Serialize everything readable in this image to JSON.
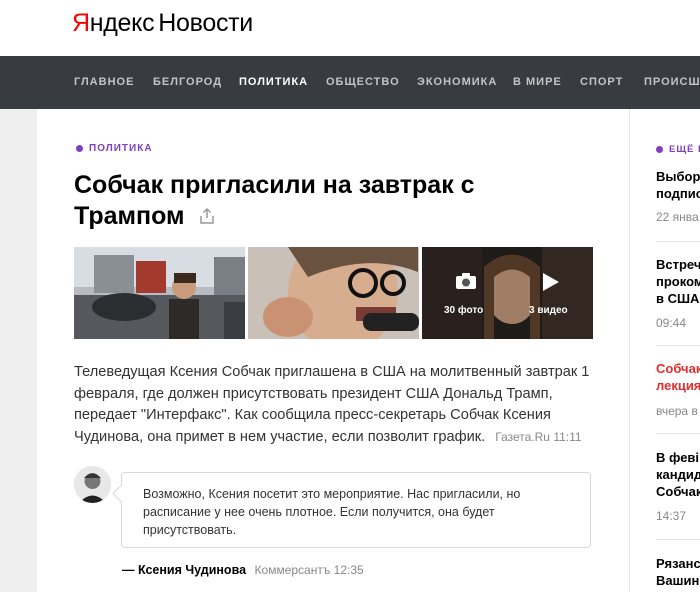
{
  "logo": {
    "brand_first": "Я",
    "brand_rest": "ндекс",
    "service": "Новости"
  },
  "nav": {
    "items": [
      {
        "label": "ГЛАВНОЕ",
        "active": false
      },
      {
        "label": "БЕЛГОРОД",
        "active": false
      },
      {
        "label": "ПОЛИТИКА",
        "active": true
      },
      {
        "label": "ОБЩЕСТВО",
        "active": false
      },
      {
        "label": "ЭКОНОМИКА",
        "active": false
      },
      {
        "label": "В МИРЕ",
        "active": false
      },
      {
        "label": "СПОРТ",
        "active": false
      },
      {
        "label": "ПРОИСШЕСТВИЯ",
        "active": false
      }
    ]
  },
  "article": {
    "rubric": "ПОЛИТИКА",
    "title": "Собчак пригласили на завтрак с Трампом",
    "share_icon": "share-icon",
    "media": {
      "photos_label": "30 фото",
      "videos_label": "3 видео",
      "camera_icon": "camera-icon",
      "play_icon": "play-icon"
    },
    "lead": "Телеведущая Ксения Собчак приглашена в США на молитвенный завтрак 1 февраля, где должен присутствовать президент США Дональд Трамп, передает \"Интерфакс\". Как сообщила пресс-секретарь Собчак Ксения Чудинова, она примет в нем участие, если позволит график.",
    "source": "Газета.Ru 11:11",
    "quote": {
      "text": "Возможно, Ксения посетит это мероприятие. Нас пригласили, но расписание у нее очень плотное. Если получится, она будет присутствовать.",
      "author": "— Ксения Чудинова",
      "source": "Коммерсантъ 12:35"
    }
  },
  "sidebar": {
    "heading": "ЕЩЁ Н",
    "items": [
      {
        "lines": [
          "Выбор",
          "подпис"
        ],
        "time": "22 янва",
        "red": false
      },
      {
        "lines": [
          "Встреч",
          "проком",
          "в США"
        ],
        "time": "09:44",
        "red": false
      },
      {
        "lines": [
          "Собчак",
          "лекция"
        ],
        "time": "вчера в",
        "red": true
      },
      {
        "lines": [
          "В феві",
          "кандид",
          "Собчак"
        ],
        "time": "14:37",
        "red": false
      },
      {
        "lines": [
          "Рязанс",
          "Вашин"
        ],
        "time": "",
        "red": false
      }
    ]
  },
  "colors": {
    "accent": "#7f3fbf",
    "nav_bg": "#383b3f",
    "logo_red": "#ff0000",
    "alert_red": "#e52b2b"
  }
}
